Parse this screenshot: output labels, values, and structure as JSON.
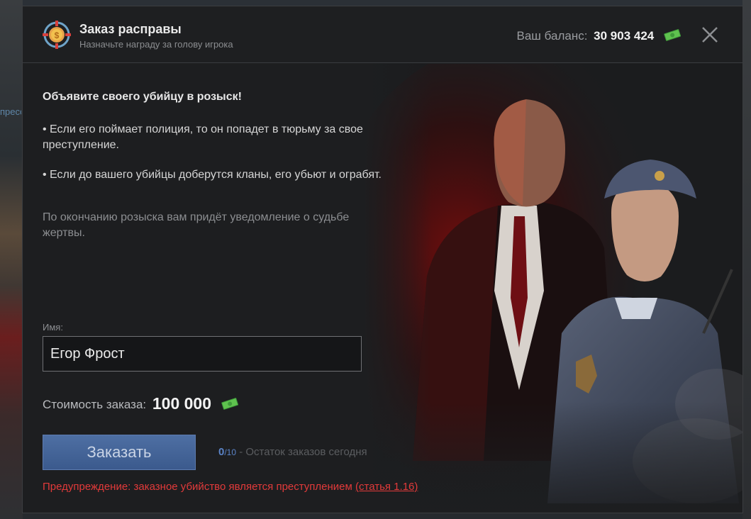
{
  "background": {
    "left_text": "пресс"
  },
  "header": {
    "title": "Заказ расправы",
    "subtitle": "Назначьте награду за голову игрока",
    "balance_label": "Ваш баланс:",
    "balance_value": "30 903 424"
  },
  "content": {
    "headline": "Объявите своего убийцу в розыск!",
    "bullet1": "•  Если его поймает полиция, то он попадет в тюрьму за свое преступление.",
    "bullet2": "•  Если до вашего убийцы доберутся кланы, его убьют и ограбят.",
    "note": "По окончанию розыска вам придёт уведомление о судьбе жертвы."
  },
  "form": {
    "name_label": "Имя:",
    "name_value": "Егор Фрост",
    "cost_label": "Стоимость заказа:",
    "cost_value": "100 000",
    "order_button": "Заказать",
    "orders_used": "0",
    "orders_total": "/10",
    "orders_text": " - Остаток заказов сегодня",
    "warning_text": "Предупреждение: заказное убийство является преступлением ",
    "warning_link": "(статья 1.16)"
  },
  "colors": {
    "accent_blue": "#3b5a8d",
    "warning_red": "#e23a3a",
    "cash_green": "#4caf50"
  },
  "icons": {
    "logo": "target-coin-icon",
    "currency": "cash-icon",
    "close": "close-icon"
  }
}
